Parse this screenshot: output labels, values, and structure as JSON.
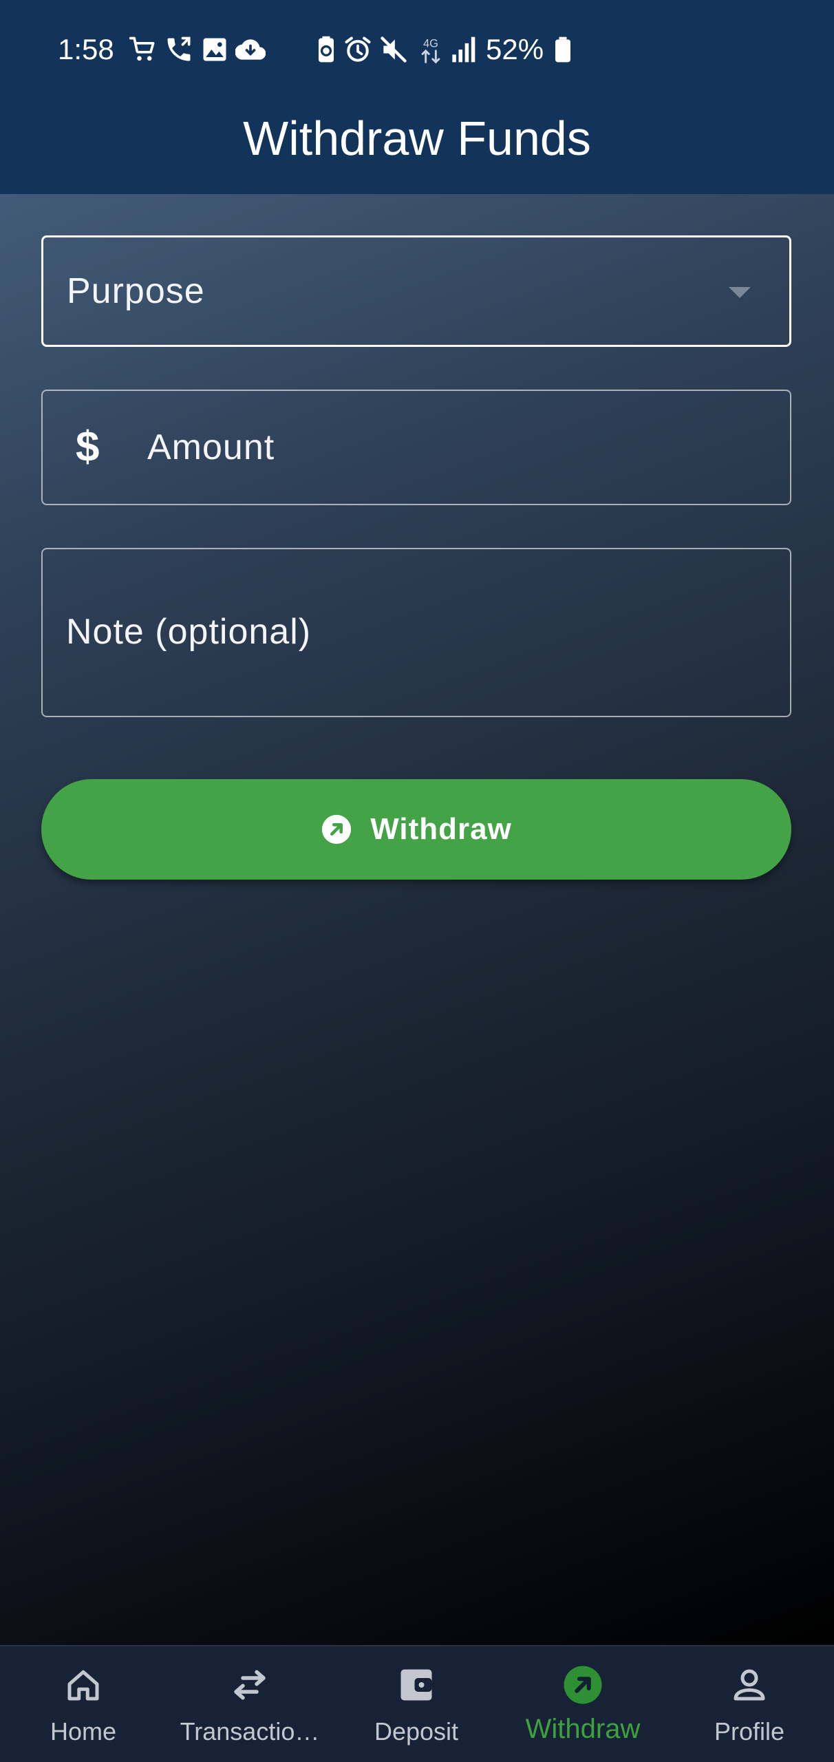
{
  "status_bar": {
    "time": "1:58",
    "battery_percent": "52%",
    "network": "4G",
    "icons": [
      "shopping-cart-icon",
      "phone-forward-icon",
      "image-icon",
      "cloud-download-icon",
      "battery-saver-icon",
      "alarm-icon",
      "mute-icon",
      "network-4g-icon",
      "signal-icon",
      "battery-icon"
    ]
  },
  "app_bar": {
    "title": "Withdraw Funds"
  },
  "form": {
    "purpose": {
      "label": "Purpose",
      "icon": "dropdown-arrow-icon"
    },
    "amount": {
      "label": "Amount",
      "icon": "dollar-icon",
      "icon_glyph": "$"
    },
    "note": {
      "label": "Note (optional)"
    },
    "submit": {
      "label": "Withdraw",
      "icon": "arrow-up-right-circle-icon"
    }
  },
  "bottom_nav": {
    "active": "Withdraw",
    "items": [
      {
        "label": "Home",
        "icon": "home-icon"
      },
      {
        "label": "Transactio…",
        "icon": "swap-arrows-icon"
      },
      {
        "label": "Deposit",
        "icon": "wallet-icon"
      },
      {
        "label": "Withdraw",
        "icon": "arrow-up-right-circle-icon"
      },
      {
        "label": "Profile",
        "icon": "person-icon"
      }
    ]
  },
  "colors": {
    "header_bg": "#12335a",
    "accent_green": "#43a346",
    "nav_bg": "#172236",
    "nav_active": "#3da13f"
  }
}
